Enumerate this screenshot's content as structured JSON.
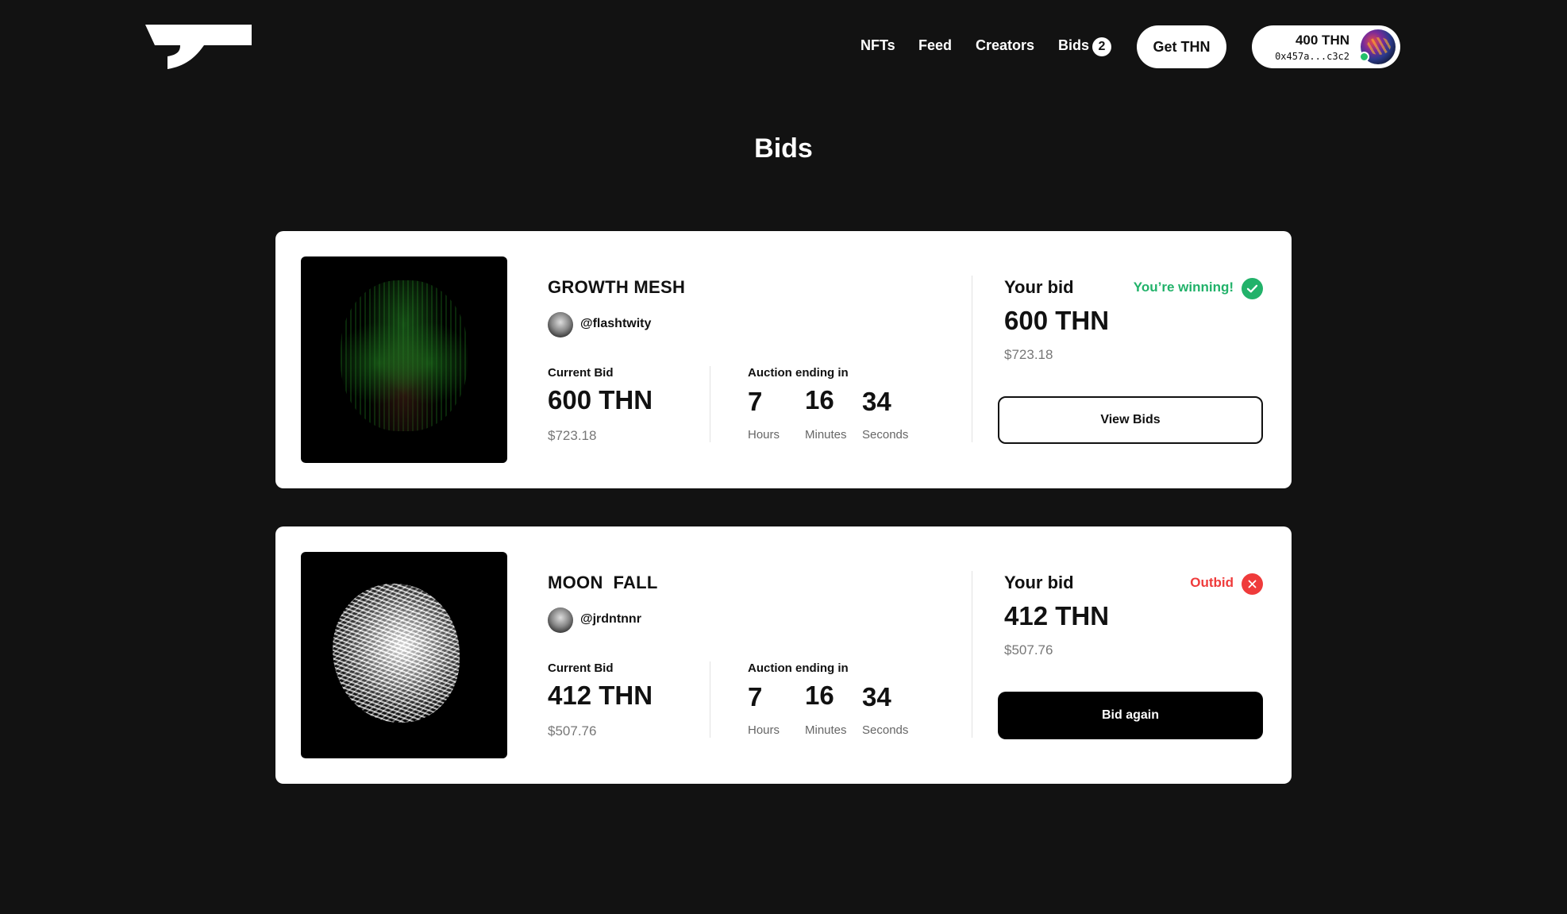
{
  "nav": {
    "links": [
      "NFTs",
      "Feed",
      "Creators",
      "Bids"
    ],
    "bids_count": "2",
    "get_button": "Get THN",
    "wallet": {
      "balance": "400 THN",
      "address": "0x457a...c3c2"
    }
  },
  "page": {
    "title": "Bids"
  },
  "cards": [
    {
      "title": "GROWTH MESH",
      "creator": "@flashtwity",
      "current_bid_label": "Current Bid",
      "current_bid": "600 THN",
      "current_bid_usd": "$723.18",
      "auction_label": "Auction ending in",
      "hours": "7",
      "minutes": "16",
      "seconds": "34",
      "hours_label": "Hours",
      "minutes_label": "Minutes",
      "seconds_label": "Seconds",
      "your_bid_label": "Your bid",
      "your_bid": "600 THN",
      "your_bid_usd": "$723.18",
      "status": "You’re winning!",
      "status_color": "#22b26a",
      "button": "View Bids"
    },
    {
      "title": "MOON  FALL",
      "creator": "@jrdntnnr",
      "current_bid_label": "Current Bid",
      "current_bid": "412 THN",
      "current_bid_usd": "$507.76",
      "auction_label": "Auction ending in",
      "hours": "7",
      "minutes": "16",
      "seconds": "34",
      "hours_label": "Hours",
      "minutes_label": "Minutes",
      "seconds_label": "Seconds",
      "your_bid_label": "Your bid",
      "your_bid": "412 THN",
      "your_bid_usd": "$507.76",
      "status": "Outbid",
      "status_color": "#ef3b3b",
      "button": "Bid again"
    }
  ],
  "colors": {
    "background": "#121212",
    "card": "#ffffff",
    "winning": "#22b26a",
    "outbid": "#ef3b3b"
  }
}
